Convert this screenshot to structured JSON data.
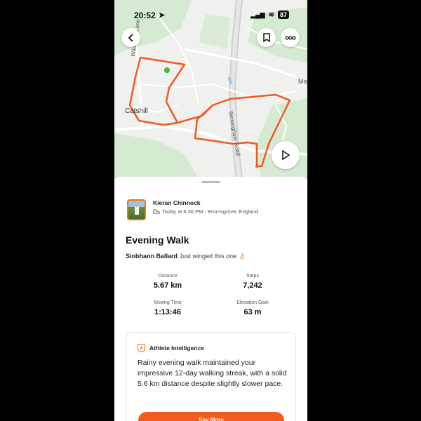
{
  "status": {
    "time": "20:52",
    "battery": "87"
  },
  "map": {
    "labels": {
      "wildmoor": "Wildmoor Lane",
      "catshill": "Catshill",
      "birmingham_road": "Birmingham Road",
      "edge": "Mar"
    },
    "route_color": "#f15a1f",
    "icons": {
      "back": "chevron-left-icon",
      "bookmark": "bookmark-icon",
      "more": "more-icon",
      "play": "play-icon"
    }
  },
  "activity": {
    "athlete": "Kieran Chinnock",
    "meta": "Today at 6:36 PM · Bromsgrove, England",
    "title": "Evening Walk",
    "kudos_name": "Siobhann Ballard",
    "kudos_text": "Just winged this one 👌🏻",
    "stats": {
      "distance": {
        "label": "Distance",
        "value": "5.67 km"
      },
      "steps": {
        "label": "Steps",
        "value": "7,242"
      },
      "moving_time": {
        "label": "Moving Time",
        "value": "1:13:46"
      },
      "elevation": {
        "label": "Elevation Gain",
        "value": "63 m"
      }
    }
  },
  "ai": {
    "title": "Athlete Intelligence",
    "text": "Rainy evening walk maintained your impressive 12-day walking streak, with a solid 5.6 km distance despite slightly slower pace.",
    "button": "Say More"
  }
}
